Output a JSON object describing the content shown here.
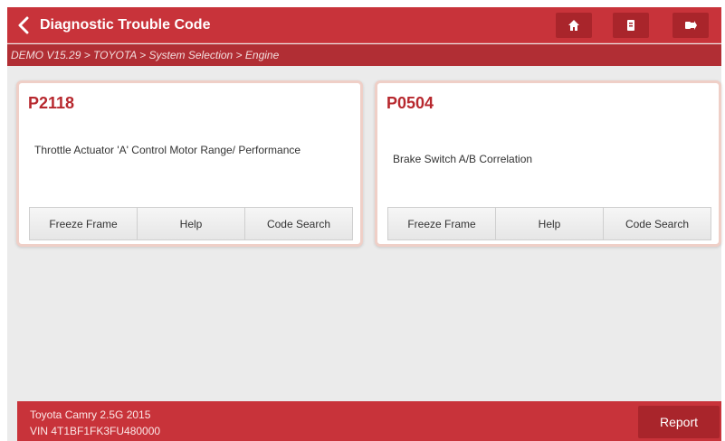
{
  "header": {
    "title": "Diagnostic Trouble Code",
    "back_icon": "chevron-left-icon",
    "buttons": [
      {
        "icon": "home-icon"
      },
      {
        "icon": "print-icon"
      },
      {
        "icon": "exit-icon"
      }
    ]
  },
  "breadcrumb": "DEMO V15.29 > TOYOTA > System Selection > Engine",
  "dtcs": [
    {
      "code": "P2118",
      "description": "Throttle Actuator 'A' Control Motor Range/ Performance",
      "actions": [
        "Freeze Frame",
        "Help",
        "Code Search"
      ]
    },
    {
      "code": "P0504",
      "description": "Brake Switch A/B Correlation",
      "actions": [
        "Freeze Frame",
        "Help",
        "Code Search"
      ]
    }
  ],
  "footer": {
    "vehicle": "Toyota Camry 2.5G 2015",
    "vin": "VIN 4T1BF1FK3FU480000",
    "report_label": "Report"
  },
  "colors": {
    "brand_red": "#c8333a",
    "dark_red": "#a9252b",
    "code_red": "#b7282e",
    "background": "#ebebeb"
  }
}
